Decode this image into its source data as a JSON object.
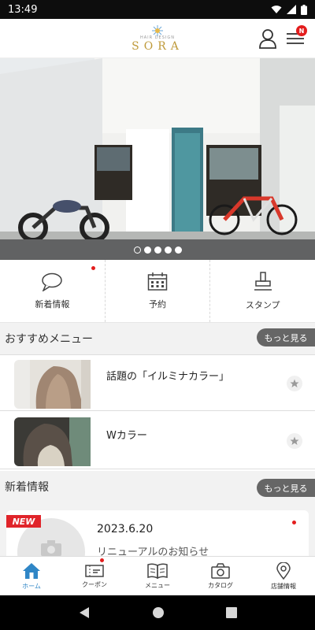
{
  "status_bar": {
    "time": "13:49"
  },
  "header": {
    "logo_small": "HAIR DESIGN",
    "logo_brand": "SORA",
    "notification_badge": "N"
  },
  "hero": {
    "slides": 5,
    "active_slide": 1
  },
  "quick_menu": [
    {
      "label": "新着情報",
      "icon": "speech-bubble-icon",
      "has_dot": true
    },
    {
      "label": "予約",
      "icon": "calendar-icon",
      "has_dot": false
    },
    {
      "label": "スタンプ",
      "icon": "stamp-icon",
      "has_dot": false
    }
  ],
  "recommended": {
    "title": "おすすめメニュー",
    "more_label": "もっと見る",
    "items": [
      {
        "title": "話題の「イルミナカラー」"
      },
      {
        "title": "Wカラー"
      }
    ]
  },
  "news": {
    "title": "新着情報",
    "more_label": "もっと見る",
    "badge": "NEW",
    "items": [
      {
        "date": "2023.6.20",
        "title": "リニューアルのお知らせ"
      }
    ]
  },
  "tabs": [
    {
      "label": "ホーム",
      "icon": "home-icon",
      "active": true
    },
    {
      "label": "クーポン",
      "icon": "coupon-icon",
      "active": false,
      "has_dot": true
    },
    {
      "label": "メニュー",
      "icon": "book-icon",
      "active": false
    },
    {
      "label": "カタログ",
      "icon": "camera-icon",
      "active": false
    },
    {
      "label": "店舗情報",
      "icon": "location-pin-icon",
      "active": false
    }
  ],
  "colors": {
    "accent": "#2f86c6",
    "brand_gold": "#bf9a3a",
    "badge_red": "#e31d1d",
    "more_button": "#666666"
  }
}
